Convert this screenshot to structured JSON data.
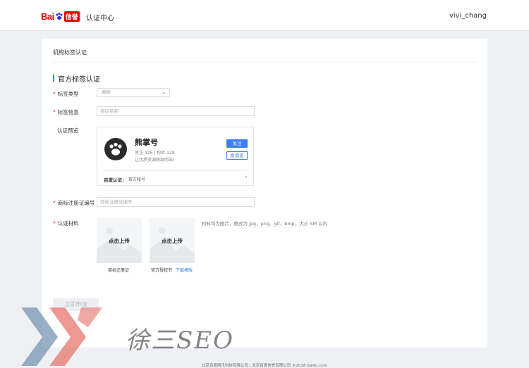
{
  "header": {
    "logo_bai": "Bai",
    "logo_xinyu": "信誉",
    "title": "认证中心",
    "username": "vivi_chang"
  },
  "page": {
    "heading": "机构标签认证",
    "section_title": "官方标签认证"
  },
  "form": {
    "tag_type_label": "标签类型",
    "tag_type_value": "商标",
    "tag_info_label": "标签信息",
    "tag_info_placeholder": "商标名称",
    "preview_label": "认证预览",
    "reg_no_label": "商标注册证编号",
    "reg_no_placeholder": "商标注册证编号",
    "materials_label": "认证材料",
    "submit_label": "立即申请"
  },
  "preview": {
    "name": "熊掌号",
    "stats": "关注  426  |  粉丝  128",
    "desc": "让优质资源脱颖而出！",
    "follow_label": "关注",
    "message_label": "发消息",
    "auth_label": "百度认证：",
    "auth_value": "官方帐号"
  },
  "uploads": {
    "upload_text": "点击上传",
    "item1_caption": "商标注册证",
    "item2_caption": "官方授权书",
    "download_link": "下载模版",
    "hint": "材料均为图片，格式为 jpg、png、gif、bmp，大小 5M 以内"
  },
  "watermark": {
    "text": "徐三SEO"
  },
  "footer": {
    "text": "北京百度网讯科技有限公司    |    北京百度信誉有限公司    ©2018 baidu.com"
  },
  "colors": {
    "accent": "#3a7ef8",
    "brand_red": "#e10602",
    "required": "#e33333"
  }
}
